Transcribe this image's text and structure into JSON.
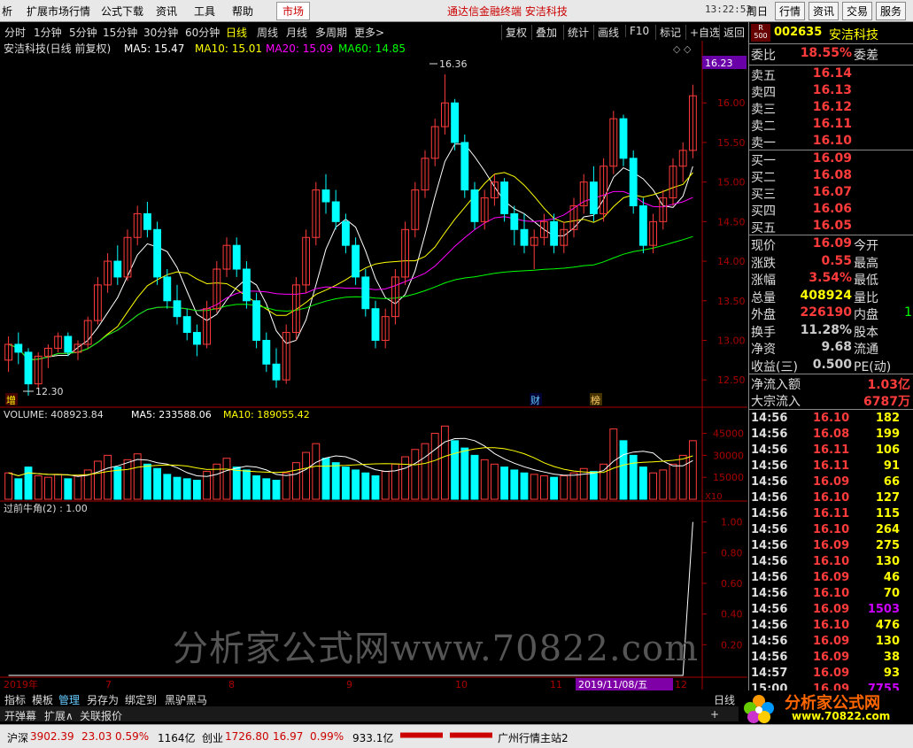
{
  "topbar": {
    "left_fragment": "析",
    "menus": [
      "扩展市场行情",
      "公式下载",
      "资讯",
      "工具",
      "帮助"
    ],
    "market_tab": "市场",
    "brand": "通达信金融终端 安洁科技",
    "clock": "13:22:53",
    "weekday": "周日",
    "buttons": [
      "行情",
      "资讯",
      "交易",
      "服务"
    ]
  },
  "periodbar": {
    "periods": [
      "分时",
      "1分钟",
      "5分钟",
      "15分钟",
      "30分钟",
      "60分钟",
      "日线",
      "周线",
      "月线",
      "多周期",
      "更多>"
    ],
    "active": "日线",
    "tools": [
      "复权",
      "叠加",
      "统计",
      "画线",
      "F10",
      "标记",
      "+自选",
      "返回"
    ]
  },
  "price_panel": {
    "title": "安洁科技(日线 前复权)",
    "ma": [
      {
        "label": "MA5: 15.47",
        "color": "#ffffff"
      },
      {
        "label": "MA10: 15.01",
        "color": "#ffff00"
      },
      {
        "label": "MA20: 15.09",
        "color": "#ff00ff"
      },
      {
        "label": "MA60: 14.85",
        "color": "#00ff00"
      }
    ],
    "y_ticks": [
      "16.00",
      "15.50",
      "15.00",
      "14.50",
      "14.00",
      "13.50",
      "13.00",
      "12.50"
    ],
    "current_price_tag": "16.23",
    "high_label": "16.36",
    "low_label": "12.30",
    "markers": [
      "增",
      "财",
      "榜"
    ]
  },
  "volume_panel": {
    "title": "VOLUME: 408923.84",
    "ma5": "MA5: 233588.06",
    "ma10": "MA10: 189055.42",
    "y_ticks": [
      "45000",
      "30000",
      "15000"
    ],
    "unit": "X10"
  },
  "indicator_panel": {
    "title": "过前牛角(2) : 1.00",
    "y_ticks": [
      "1.00",
      "0.80",
      "0.60",
      "0.40",
      "0.20"
    ]
  },
  "x_axis": {
    "labels": [
      "2019年",
      "7",
      "8",
      "9",
      "10",
      "11",
      "12"
    ],
    "cursor_date": "2019/11/08/五"
  },
  "watermark": "分析家公式网www.70822.com",
  "tabbar": {
    "items": [
      "指标",
      "模板",
      "管理",
      "另存为",
      "绑定到",
      "黑驴黑马"
    ],
    "active": "管理",
    "right": "日线",
    "plus": "+"
  },
  "funcbar": {
    "items": [
      "开弹幕",
      "扩展∧",
      "关联报价"
    ]
  },
  "quote": {
    "code": "002635",
    "name": "安洁科技",
    "badge_top": "R",
    "badge_bottom": "500",
    "weibi_label": "委比",
    "weibi_value": "18.55%",
    "weicha_label": "委差",
    "asks": [
      {
        "label": "卖五",
        "price": "16.14"
      },
      {
        "label": "卖四",
        "price": "16.13"
      },
      {
        "label": "卖三",
        "price": "16.12"
      },
      {
        "label": "卖二",
        "price": "16.11"
      },
      {
        "label": "卖一",
        "price": "16.10"
      }
    ],
    "bids": [
      {
        "label": "买一",
        "price": "16.09"
      },
      {
        "label": "买二",
        "price": "16.08"
      },
      {
        "label": "买三",
        "price": "16.07"
      },
      {
        "label": "买四",
        "price": "16.06"
      },
      {
        "label": "买五",
        "price": "16.05"
      }
    ],
    "stats": [
      {
        "label": "现价",
        "value": "16.09",
        "label2": "今开",
        "color": "red"
      },
      {
        "label": "涨跌",
        "value": "0.55",
        "label2": "最高",
        "color": "red"
      },
      {
        "label": "涨幅",
        "value": "3.54%",
        "label2": "最低",
        "color": "red"
      },
      {
        "label": "总量",
        "value": "408924",
        "label2": "量比",
        "color": "ylw"
      },
      {
        "label": "外盘",
        "value": "226190",
        "label2": "内盘",
        "color": "red",
        "extra": "1"
      },
      {
        "label": "换手",
        "value": "11.28%",
        "label2": "股本",
        "color": "white"
      },
      {
        "label": "净资",
        "value": "9.68",
        "label2": "流通",
        "color": "white"
      },
      {
        "label": "收益(三)",
        "value": "0.500",
        "label2": "PE(动)",
        "color": "white"
      }
    ],
    "flows": [
      {
        "label": "净流入额",
        "value": "1.03亿"
      },
      {
        "label": "大宗流入",
        "value": "6787万"
      }
    ],
    "ticks": [
      {
        "time": "14:56",
        "price": "16.10",
        "vol": "182",
        "color": "ylw"
      },
      {
        "time": "14:56",
        "price": "16.08",
        "vol": "199",
        "color": "ylw"
      },
      {
        "time": "14:56",
        "price": "16.11",
        "vol": "106",
        "color": "ylw"
      },
      {
        "time": "14:56",
        "price": "16.11",
        "vol": "91",
        "color": "ylw"
      },
      {
        "time": "14:56",
        "price": "16.09",
        "vol": "66",
        "color": "ylw"
      },
      {
        "time": "14:56",
        "price": "16.10",
        "vol": "127",
        "color": "ylw"
      },
      {
        "time": "14:56",
        "price": "16.11",
        "vol": "115",
        "color": "ylw"
      },
      {
        "time": "14:56",
        "price": "16.10",
        "vol": "264",
        "color": "ylw"
      },
      {
        "time": "14:56",
        "price": "16.09",
        "vol": "275",
        "color": "ylw"
      },
      {
        "time": "14:56",
        "price": "16.10",
        "vol": "130",
        "color": "ylw"
      },
      {
        "time": "14:56",
        "price": "16.09",
        "vol": "46",
        "color": "ylw"
      },
      {
        "time": "14:56",
        "price": "16.10",
        "vol": "70",
        "color": "ylw"
      },
      {
        "time": "14:56",
        "price": "16.09",
        "vol": "1503",
        "color": "purple"
      },
      {
        "time": "14:56",
        "price": "16.10",
        "vol": "476",
        "color": "ylw"
      },
      {
        "time": "14:56",
        "price": "16.09",
        "vol": "130",
        "color": "ylw"
      },
      {
        "time": "14:56",
        "price": "16.09",
        "vol": "38",
        "color": "ylw"
      },
      {
        "time": "14:57",
        "price": "16.09",
        "vol": "93",
        "color": "ylw"
      },
      {
        "time": "15:00",
        "price": "16.09",
        "vol": "7755",
        "color": "purple"
      }
    ]
  },
  "statusbar": {
    "hs_label": "沪深",
    "hs_value": "3902.39",
    "hs_change": "23.03",
    "hs_pct": "0.59%",
    "hs_amount": "1164亿",
    "cy_label": "创业",
    "cy_value": "1726.80",
    "cy_change": "16.97",
    "cy_pct": "0.99%",
    "cy_amount": "933.1亿",
    "site": "广州行情主站2"
  },
  "logo": {
    "text": "分析家公式网",
    "url": "www.70822.com"
  },
  "colors": {
    "up": "#ff3b3b",
    "down": "#00ffff",
    "ma5": "#ffffff",
    "ma10": "#ffff00",
    "ma20": "#ff00ff",
    "ma60": "#00ff00"
  },
  "chart_data": {
    "type": "candlestick",
    "ohlc": [
      [
        12.75,
        13.05,
        12.6,
        12.95
      ],
      [
        12.95,
        13.1,
        12.7,
        12.85
      ],
      [
        12.85,
        12.9,
        12.3,
        12.45
      ],
      [
        12.45,
        12.85,
        12.4,
        12.8
      ],
      [
        12.8,
        12.95,
        12.65,
        12.9
      ],
      [
        12.9,
        13.1,
        12.85,
        13.05
      ],
      [
        13.05,
        13.1,
        12.8,
        12.85
      ],
      [
        12.85,
        13.0,
        12.75,
        12.95
      ],
      [
        12.95,
        13.3,
        12.9,
        13.25
      ],
      [
        13.25,
        13.8,
        13.2,
        13.7
      ],
      [
        13.7,
        14.1,
        13.6,
        14.0
      ],
      [
        14.0,
        14.2,
        13.7,
        13.8
      ],
      [
        13.8,
        14.4,
        13.75,
        14.3
      ],
      [
        14.3,
        14.7,
        14.2,
        14.6
      ],
      [
        14.6,
        14.75,
        14.3,
        14.4
      ],
      [
        14.4,
        14.5,
        13.7,
        13.8
      ],
      [
        13.8,
        13.9,
        13.4,
        13.5
      ],
      [
        13.5,
        13.7,
        13.2,
        13.3
      ],
      [
        13.3,
        13.4,
        13.0,
        13.1
      ],
      [
        13.1,
        13.2,
        12.8,
        12.95
      ],
      [
        12.95,
        13.5,
        12.9,
        13.4
      ],
      [
        13.4,
        14.0,
        13.35,
        13.9
      ],
      [
        13.9,
        14.3,
        13.8,
        14.2
      ],
      [
        14.2,
        14.3,
        13.8,
        13.9
      ],
      [
        13.9,
        14.0,
        13.4,
        13.5
      ],
      [
        13.5,
        13.6,
        12.9,
        13.0
      ],
      [
        13.0,
        13.1,
        12.6,
        12.7
      ],
      [
        12.7,
        12.9,
        12.4,
        12.5
      ],
      [
        12.5,
        13.2,
        12.45,
        13.1
      ],
      [
        13.1,
        13.8,
        13.0,
        13.7
      ],
      [
        13.7,
        14.4,
        13.6,
        14.3
      ],
      [
        14.3,
        15.0,
        14.2,
        14.9
      ],
      [
        14.9,
        15.1,
        14.6,
        14.75
      ],
      [
        14.75,
        14.9,
        14.4,
        14.5
      ],
      [
        14.5,
        14.6,
        14.1,
        14.2
      ],
      [
        14.2,
        14.3,
        13.7,
        13.8
      ],
      [
        13.8,
        13.9,
        13.3,
        13.4
      ],
      [
        13.4,
        13.5,
        12.9,
        13.0
      ],
      [
        13.0,
        13.4,
        12.9,
        13.3
      ],
      [
        13.3,
        13.9,
        13.2,
        13.8
      ],
      [
        13.8,
        14.5,
        13.7,
        14.4
      ],
      [
        14.4,
        15.0,
        14.3,
        14.9
      ],
      [
        14.9,
        15.4,
        14.8,
        15.3
      ],
      [
        15.3,
        15.8,
        15.2,
        15.7
      ],
      [
        15.7,
        16.36,
        15.6,
        16.0
      ],
      [
        16.0,
        16.05,
        15.4,
        15.5
      ],
      [
        15.5,
        15.6,
        14.8,
        14.9
      ],
      [
        14.9,
        15.0,
        14.4,
        14.5
      ],
      [
        14.5,
        14.9,
        14.4,
        14.8
      ],
      [
        14.8,
        15.1,
        14.7,
        15.0
      ],
      [
        15.0,
        15.05,
        14.5,
        14.6
      ],
      [
        14.6,
        14.7,
        14.2,
        14.4
      ],
      [
        14.4,
        14.6,
        14.1,
        14.2
      ],
      [
        14.2,
        14.4,
        13.9,
        14.3
      ],
      [
        14.3,
        14.6,
        14.2,
        14.5
      ],
      [
        14.5,
        14.6,
        14.1,
        14.2
      ],
      [
        14.2,
        14.5,
        14.1,
        14.4
      ],
      [
        14.4,
        14.8,
        14.3,
        14.7
      ],
      [
        14.7,
        15.1,
        14.6,
        15.0
      ],
      [
        15.0,
        15.2,
        14.5,
        14.6
      ],
      [
        14.6,
        15.3,
        14.5,
        15.2
      ],
      [
        15.2,
        15.9,
        15.1,
        15.8
      ],
      [
        15.8,
        15.85,
        15.2,
        15.3
      ],
      [
        15.3,
        15.4,
        14.6,
        14.7
      ],
      [
        14.7,
        14.8,
        14.1,
        14.2
      ],
      [
        14.2,
        14.6,
        14.1,
        14.5
      ],
      [
        14.5,
        14.9,
        14.4,
        14.8
      ],
      [
        14.8,
        15.3,
        14.7,
        15.2
      ],
      [
        15.2,
        15.5,
        15.0,
        15.4
      ],
      [
        15.4,
        16.23,
        15.3,
        16.09
      ]
    ],
    "volume": [
      18,
      14,
      22,
      16,
      15,
      17,
      14,
      16,
      20,
      26,
      30,
      22,
      27,
      31,
      24,
      21,
      17,
      15,
      14,
      13,
      19,
      24,
      28,
      22,
      20,
      16,
      14,
      13,
      18,
      25,
      32,
      38,
      28,
      25,
      22,
      20,
      18,
      16,
      19,
      24,
      29,
      34,
      38,
      45,
      50,
      40,
      35,
      30,
      27,
      24,
      22,
      20,
      18,
      17,
      16,
      15,
      16,
      18,
      21,
      19,
      24,
      48,
      40,
      30,
      22,
      18,
      20,
      24,
      30,
      40
    ],
    "indicator": [
      0,
      0,
      0,
      0,
      0,
      0,
      0,
      0,
      0,
      0,
      0,
      0,
      0,
      0,
      0,
      0,
      0,
      0,
      0,
      0,
      0,
      0,
      0,
      0,
      0,
      0,
      0,
      0,
      0,
      0,
      0,
      0,
      0,
      0,
      0,
      0,
      0,
      0,
      0,
      0,
      0,
      0,
      0,
      0,
      0,
      0,
      0,
      0,
      0,
      0,
      0,
      0,
      0,
      0,
      0,
      0,
      0,
      0,
      0,
      0,
      0,
      0,
      0,
      0,
      0,
      0,
      0,
      0,
      0,
      1
    ],
    "ylim_price": [
      12.2,
      16.45
    ],
    "ylim_volume": [
      0,
      52000
    ],
    "ylim_indicator": [
      0,
      1.05
    ]
  }
}
